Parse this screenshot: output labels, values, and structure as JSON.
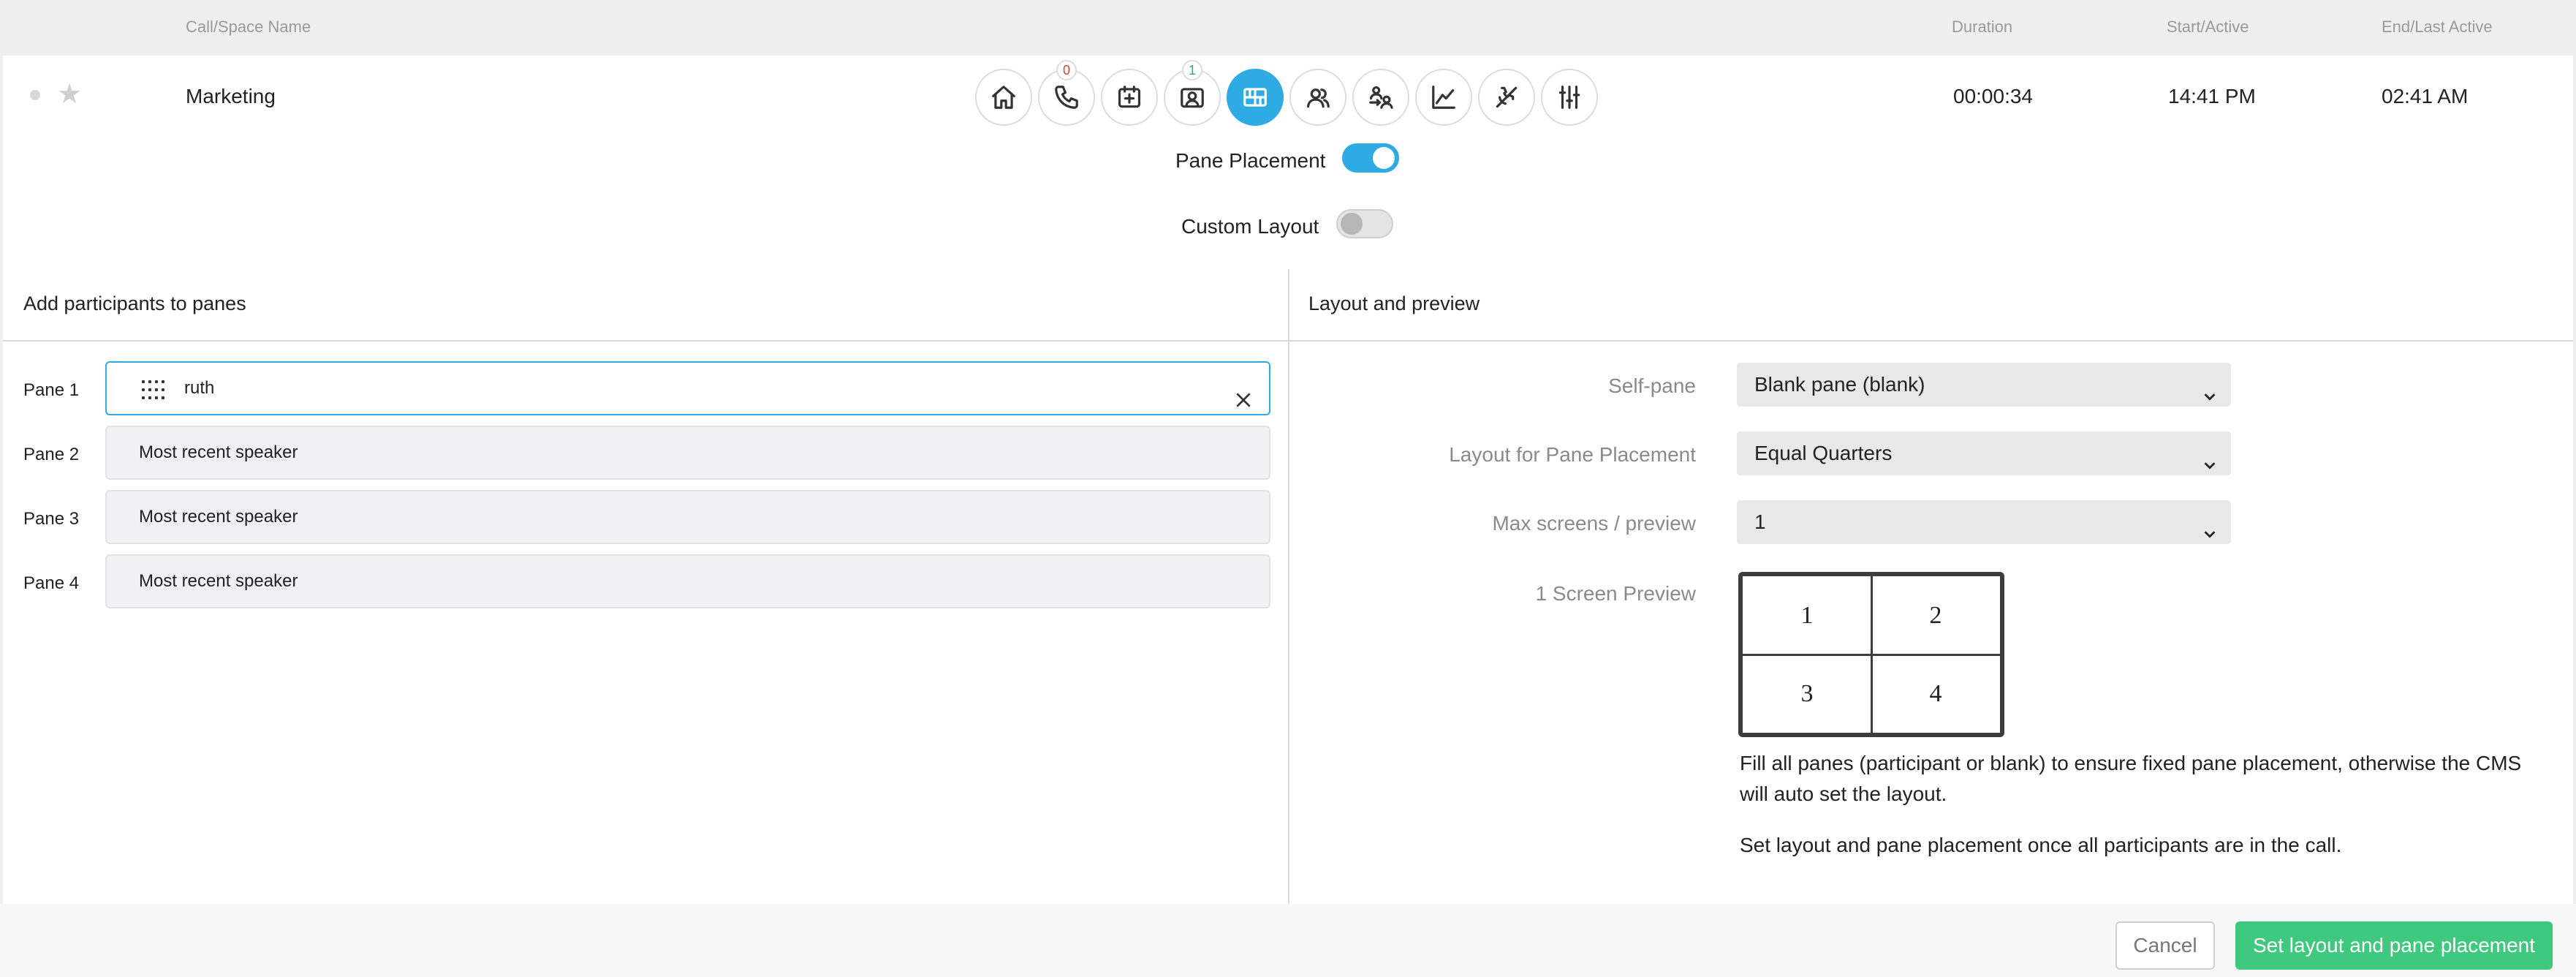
{
  "columns": {
    "name": "Call/Space Name",
    "duration": "Duration",
    "start": "Start/Active",
    "end": "End/Last Active"
  },
  "call": {
    "name": "Marketing",
    "duration": "00:00:34",
    "start": "14:41 PM",
    "end": "02:41 AM"
  },
  "toolbar": {
    "icons": [
      "home-icon",
      "phone-icon",
      "calendar-add-icon",
      "participant-icon",
      "layout-icon",
      "users-icon",
      "transfer-icon",
      "chart-icon",
      "mute-icon",
      "sliders-icon"
    ],
    "phone_badge": "0",
    "participant_badge": "1",
    "active_icon": "layout-icon",
    "accent": "#2eabe2"
  },
  "toggles": {
    "pane_placement_label": "Pane Placement",
    "pane_placement_on": true,
    "custom_layout_label": "Custom Layout",
    "custom_layout_on": false
  },
  "left_panel": {
    "title": "Add participants to panes",
    "panes": [
      {
        "label": "Pane 1",
        "value": "ruth"
      },
      {
        "label": "Pane 2",
        "value": "Most recent speaker"
      },
      {
        "label": "Pane 3",
        "value": "Most recent speaker"
      },
      {
        "label": "Pane 4",
        "value": "Most recent speaker"
      }
    ]
  },
  "right_panel": {
    "title": "Layout and preview",
    "self_pane_label": "Self-pane",
    "self_pane_value": "Blank pane (blank)",
    "layout_label": "Layout for Pane Placement",
    "layout_value": "Equal Quarters",
    "max_screens_label": "Max screens / preview",
    "max_screens_value": "1",
    "preview_label": "1 Screen Preview",
    "preview_cells": [
      "1",
      "2",
      "3",
      "4"
    ],
    "help_1": "Fill all panes (participant or blank) to ensure fixed pane placement, otherwise the CMS will auto set the layout.",
    "help_2": "Set layout and pane placement once all participants are in the call."
  },
  "footer": {
    "cancel_label": "Cancel",
    "submit_label": "Set layout and pane placement",
    "submit_color": "#3ec97f"
  }
}
